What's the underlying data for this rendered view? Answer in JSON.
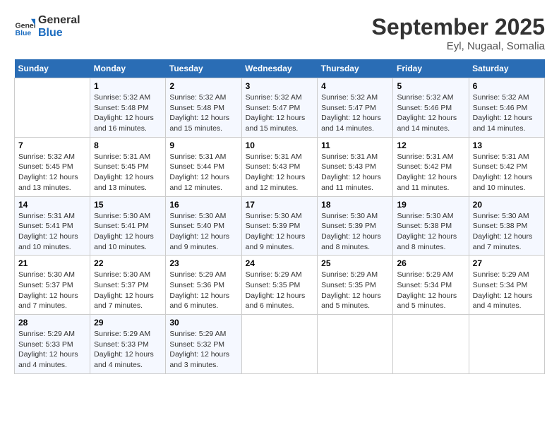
{
  "header": {
    "logo_line1": "General",
    "logo_line2": "Blue",
    "month": "September 2025",
    "location": "Eyl, Nugaal, Somalia"
  },
  "days_of_week": [
    "Sunday",
    "Monday",
    "Tuesday",
    "Wednesday",
    "Thursday",
    "Friday",
    "Saturday"
  ],
  "weeks": [
    [
      {
        "day": "",
        "info": ""
      },
      {
        "day": "1",
        "info": "Sunrise: 5:32 AM\nSunset: 5:48 PM\nDaylight: 12 hours\nand 16 minutes."
      },
      {
        "day": "2",
        "info": "Sunrise: 5:32 AM\nSunset: 5:48 PM\nDaylight: 12 hours\nand 15 minutes."
      },
      {
        "day": "3",
        "info": "Sunrise: 5:32 AM\nSunset: 5:47 PM\nDaylight: 12 hours\nand 15 minutes."
      },
      {
        "day": "4",
        "info": "Sunrise: 5:32 AM\nSunset: 5:47 PM\nDaylight: 12 hours\nand 14 minutes."
      },
      {
        "day": "5",
        "info": "Sunrise: 5:32 AM\nSunset: 5:46 PM\nDaylight: 12 hours\nand 14 minutes."
      },
      {
        "day": "6",
        "info": "Sunrise: 5:32 AM\nSunset: 5:46 PM\nDaylight: 12 hours\nand 14 minutes."
      }
    ],
    [
      {
        "day": "7",
        "info": "Sunrise: 5:32 AM\nSunset: 5:45 PM\nDaylight: 12 hours\nand 13 minutes."
      },
      {
        "day": "8",
        "info": "Sunrise: 5:31 AM\nSunset: 5:45 PM\nDaylight: 12 hours\nand 13 minutes."
      },
      {
        "day": "9",
        "info": "Sunrise: 5:31 AM\nSunset: 5:44 PM\nDaylight: 12 hours\nand 12 minutes."
      },
      {
        "day": "10",
        "info": "Sunrise: 5:31 AM\nSunset: 5:43 PM\nDaylight: 12 hours\nand 12 minutes."
      },
      {
        "day": "11",
        "info": "Sunrise: 5:31 AM\nSunset: 5:43 PM\nDaylight: 12 hours\nand 11 minutes."
      },
      {
        "day": "12",
        "info": "Sunrise: 5:31 AM\nSunset: 5:42 PM\nDaylight: 12 hours\nand 11 minutes."
      },
      {
        "day": "13",
        "info": "Sunrise: 5:31 AM\nSunset: 5:42 PM\nDaylight: 12 hours\nand 10 minutes."
      }
    ],
    [
      {
        "day": "14",
        "info": "Sunrise: 5:31 AM\nSunset: 5:41 PM\nDaylight: 12 hours\nand 10 minutes."
      },
      {
        "day": "15",
        "info": "Sunrise: 5:30 AM\nSunset: 5:41 PM\nDaylight: 12 hours\nand 10 minutes."
      },
      {
        "day": "16",
        "info": "Sunrise: 5:30 AM\nSunset: 5:40 PM\nDaylight: 12 hours\nand 9 minutes."
      },
      {
        "day": "17",
        "info": "Sunrise: 5:30 AM\nSunset: 5:39 PM\nDaylight: 12 hours\nand 9 minutes."
      },
      {
        "day": "18",
        "info": "Sunrise: 5:30 AM\nSunset: 5:39 PM\nDaylight: 12 hours\nand 8 minutes."
      },
      {
        "day": "19",
        "info": "Sunrise: 5:30 AM\nSunset: 5:38 PM\nDaylight: 12 hours\nand 8 minutes."
      },
      {
        "day": "20",
        "info": "Sunrise: 5:30 AM\nSunset: 5:38 PM\nDaylight: 12 hours\nand 7 minutes."
      }
    ],
    [
      {
        "day": "21",
        "info": "Sunrise: 5:30 AM\nSunset: 5:37 PM\nDaylight: 12 hours\nand 7 minutes."
      },
      {
        "day": "22",
        "info": "Sunrise: 5:30 AM\nSunset: 5:37 PM\nDaylight: 12 hours\nand 7 minutes."
      },
      {
        "day": "23",
        "info": "Sunrise: 5:29 AM\nSunset: 5:36 PM\nDaylight: 12 hours\nand 6 minutes."
      },
      {
        "day": "24",
        "info": "Sunrise: 5:29 AM\nSunset: 5:35 PM\nDaylight: 12 hours\nand 6 minutes."
      },
      {
        "day": "25",
        "info": "Sunrise: 5:29 AM\nSunset: 5:35 PM\nDaylight: 12 hours\nand 5 minutes."
      },
      {
        "day": "26",
        "info": "Sunrise: 5:29 AM\nSunset: 5:34 PM\nDaylight: 12 hours\nand 5 minutes."
      },
      {
        "day": "27",
        "info": "Sunrise: 5:29 AM\nSunset: 5:34 PM\nDaylight: 12 hours\nand 4 minutes."
      }
    ],
    [
      {
        "day": "28",
        "info": "Sunrise: 5:29 AM\nSunset: 5:33 PM\nDaylight: 12 hours\nand 4 minutes."
      },
      {
        "day": "29",
        "info": "Sunrise: 5:29 AM\nSunset: 5:33 PM\nDaylight: 12 hours\nand 4 minutes."
      },
      {
        "day": "30",
        "info": "Sunrise: 5:29 AM\nSunset: 5:32 PM\nDaylight: 12 hours\nand 3 minutes."
      },
      {
        "day": "",
        "info": ""
      },
      {
        "day": "",
        "info": ""
      },
      {
        "day": "",
        "info": ""
      },
      {
        "day": "",
        "info": ""
      }
    ]
  ]
}
